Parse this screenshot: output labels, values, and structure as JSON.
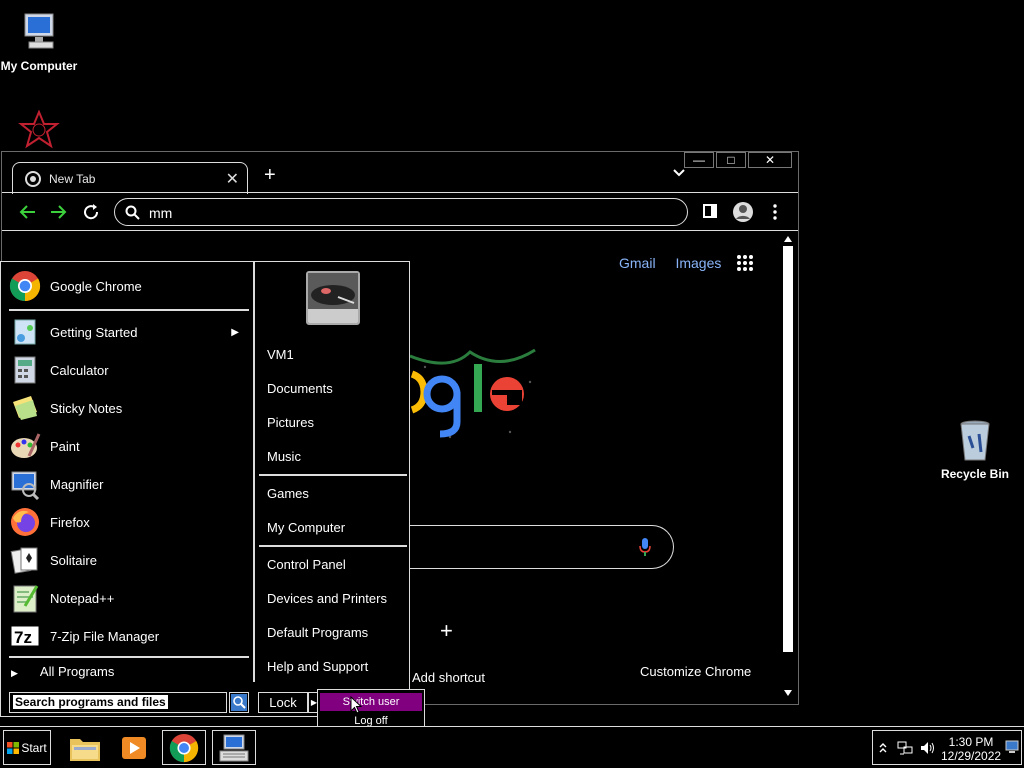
{
  "desktop": {
    "icons": [
      {
        "label": "My Computer",
        "icon": "computer-icon"
      },
      {
        "label": "",
        "icon": "app-shortcut-icon"
      },
      {
        "label": "Recycle Bin",
        "icon": "recycle-bin-icon"
      }
    ]
  },
  "browser": {
    "tab_title": "New Tab",
    "tab_close": "✕",
    "new_tab": "+",
    "address_value": "mm",
    "ntp": {
      "gmail": "Gmail",
      "images": "Images",
      "add_shortcut_plus": "+",
      "add_shortcut": "Add shortcut",
      "customize": "Customize Chrome"
    },
    "controls": {
      "minimize": "—",
      "maximize": "□",
      "close": "✕"
    }
  },
  "start_menu": {
    "pinned": [
      {
        "label": "Google Chrome",
        "icon": "chrome-icon"
      }
    ],
    "programs": [
      {
        "label": "Getting Started",
        "icon": "getting-started-icon",
        "submenu": true
      },
      {
        "label": "Calculator",
        "icon": "calculator-icon"
      },
      {
        "label": "Sticky Notes",
        "icon": "sticky-notes-icon"
      },
      {
        "label": "Paint",
        "icon": "paint-icon"
      },
      {
        "label": "Magnifier",
        "icon": "magnifier-icon"
      },
      {
        "label": "Firefox",
        "icon": "firefox-icon"
      },
      {
        "label": "Solitaire",
        "icon": "solitaire-icon"
      },
      {
        "label": "Notepad++",
        "icon": "notepadpp-icon"
      },
      {
        "label": "7-Zip File Manager",
        "icon": "sevenzip-icon"
      }
    ],
    "all_programs": "All Programs",
    "right": {
      "user": "VM1",
      "group1": [
        "Documents",
        "Pictures",
        "Music"
      ],
      "group2": [
        "Games",
        "My Computer"
      ],
      "group3": [
        "Control Panel",
        "Devices and Printers",
        "Default Programs",
        "Help and Support"
      ]
    },
    "search_placeholder": "Search programs and files",
    "lock": "Lock",
    "power_menu": [
      {
        "label": "Switch user",
        "active": true
      },
      {
        "label": "Log off",
        "active": false
      }
    ]
  },
  "taskbar": {
    "start": "Start",
    "time": "1:30 PM",
    "date": "12/29/2022"
  },
  "colors": {
    "accent": "#800080",
    "link": "#8ab4f8"
  }
}
